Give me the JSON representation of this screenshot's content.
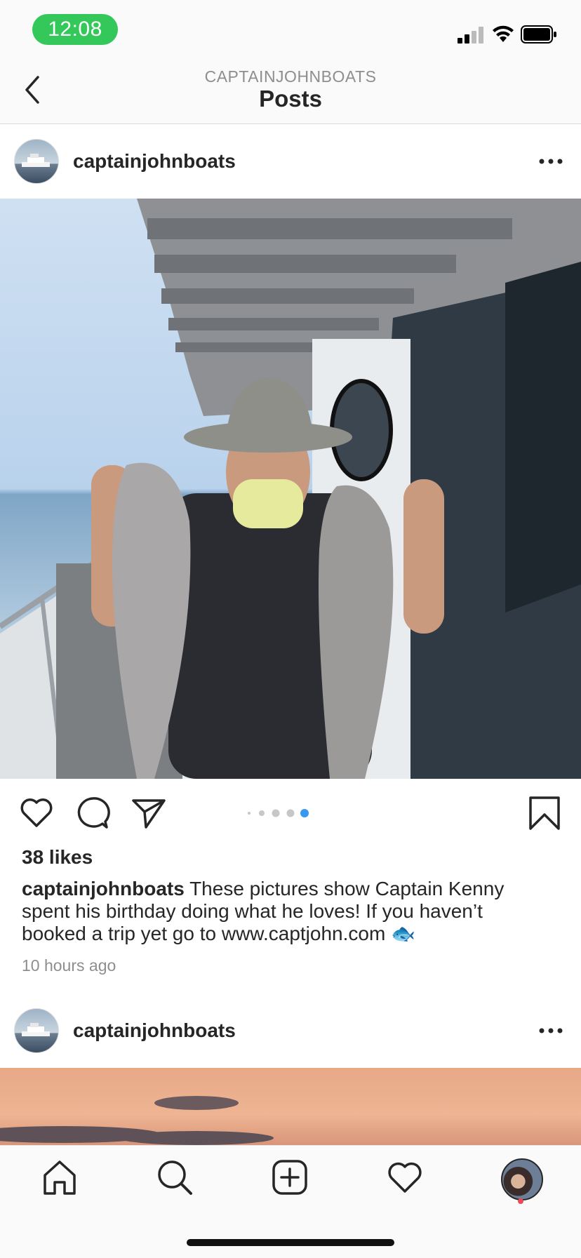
{
  "status_bar": {
    "time": "12:08",
    "icons": [
      "cellular-signal-icon",
      "wifi-icon",
      "battery-icon"
    ]
  },
  "header": {
    "subtitle": "CAPTAINJOHNBOATS",
    "title": "Posts",
    "back_icon": "chevron-left-icon"
  },
  "posts": [
    {
      "username": "captainjohnboats",
      "likes": "38 likes",
      "caption_user": "captainjohnboats",
      "caption_text": "These pictures show Captain Kenny spent his birthday doing what he loves! If you haven’t booked a trip yet go to www.captjohn.com 🐟",
      "timestamp": "10 hours ago",
      "carousel": {
        "count": 5,
        "active_index": 4
      }
    },
    {
      "username": "captainjohnboats"
    }
  ],
  "tabbar": {
    "items": [
      "home-icon",
      "search-icon",
      "new-post-icon",
      "activity-heart-icon",
      "profile-avatar"
    ]
  },
  "colors": {
    "accent_blue": "#3897f0",
    "status_green": "#34c759",
    "notification_red": "#ed4956"
  }
}
